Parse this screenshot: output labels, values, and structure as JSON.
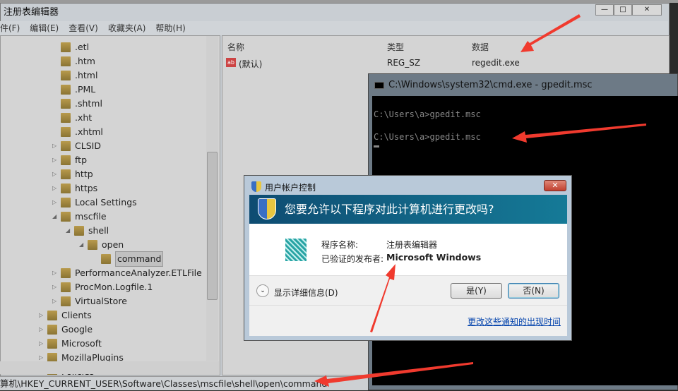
{
  "regedit": {
    "title": "注册表编辑器",
    "menu": [
      "件(F)",
      "编辑(E)",
      "查看(V)",
      "收藏夹(A)",
      "帮助(H)"
    ],
    "tree": [
      {
        "label": ".etl",
        "level": 3,
        "expander": "none"
      },
      {
        "label": ".htm",
        "level": 3,
        "expander": "none"
      },
      {
        "label": ".html",
        "level": 3,
        "expander": "none"
      },
      {
        "label": ".PML",
        "level": 3,
        "expander": "none"
      },
      {
        "label": ".shtml",
        "level": 3,
        "expander": "none"
      },
      {
        "label": ".xht",
        "level": 3,
        "expander": "none"
      },
      {
        "label": ".xhtml",
        "level": 3,
        "expander": "none"
      },
      {
        "label": "CLSID",
        "level": 3,
        "expander": "collapsed"
      },
      {
        "label": "ftp",
        "level": 3,
        "expander": "collapsed"
      },
      {
        "label": "http",
        "level": 3,
        "expander": "collapsed"
      },
      {
        "label": "https",
        "level": 3,
        "expander": "collapsed"
      },
      {
        "label": "Local Settings",
        "level": 3,
        "expander": "collapsed"
      },
      {
        "label": "mscfile",
        "level": 3,
        "expander": "expanded"
      },
      {
        "label": "shell",
        "level": 4,
        "expander": "expanded"
      },
      {
        "label": "open",
        "level": 5,
        "expander": "expanded"
      },
      {
        "label": "command",
        "level": 6,
        "expander": "none",
        "selected": true
      },
      {
        "label": "PerformanceAnalyzer.ETLFile",
        "level": 3,
        "expander": "collapsed"
      },
      {
        "label": "ProcMon.Logfile.1",
        "level": 3,
        "expander": "collapsed"
      },
      {
        "label": "VirtualStore",
        "level": 3,
        "expander": "collapsed"
      },
      {
        "label": "Clients",
        "level": 2,
        "expander": "collapsed"
      },
      {
        "label": "Google",
        "level": 2,
        "expander": "collapsed"
      },
      {
        "label": "Microsoft",
        "level": 2,
        "expander": "collapsed"
      },
      {
        "label": "MozillaPlugins",
        "level": 2,
        "expander": "collapsed"
      },
      {
        "label": "Policies",
        "level": 2,
        "expander": "collapsed"
      }
    ],
    "columns": {
      "name": "名称",
      "type": "类型",
      "data": "数据"
    },
    "values": [
      {
        "name": "(默认)",
        "type": "REG_SZ",
        "data": "regedit.exe"
      }
    ],
    "status": "算机\\HKEY_CURRENT_USER\\Software\\Classes\\mscfile\\shell\\open\\command"
  },
  "cmd": {
    "title": "C:\\Windows\\system32\\cmd.exe - gpedit.msc",
    "lines": [
      "C:\\Users\\a>gpedit.msc",
      "C:\\Users\\a>gpedit.msc"
    ]
  },
  "uac": {
    "title": "用户帐户控制",
    "question": "您要允许以下程序对此计算机进行更改吗?",
    "program_label": "程序名称:",
    "program_value": "注册表编辑器",
    "publisher_label": "已验证的发布者:",
    "publisher_value": "Microsoft Windows",
    "details": "显示详细信息(D)",
    "yes": "是(Y)",
    "no": "否(N)",
    "link": "更改这些通知的出现时间"
  },
  "colors": {
    "banner": "#0e4c72",
    "annotation_arrow": "#f03a2e",
    "link": "#0645ad"
  }
}
